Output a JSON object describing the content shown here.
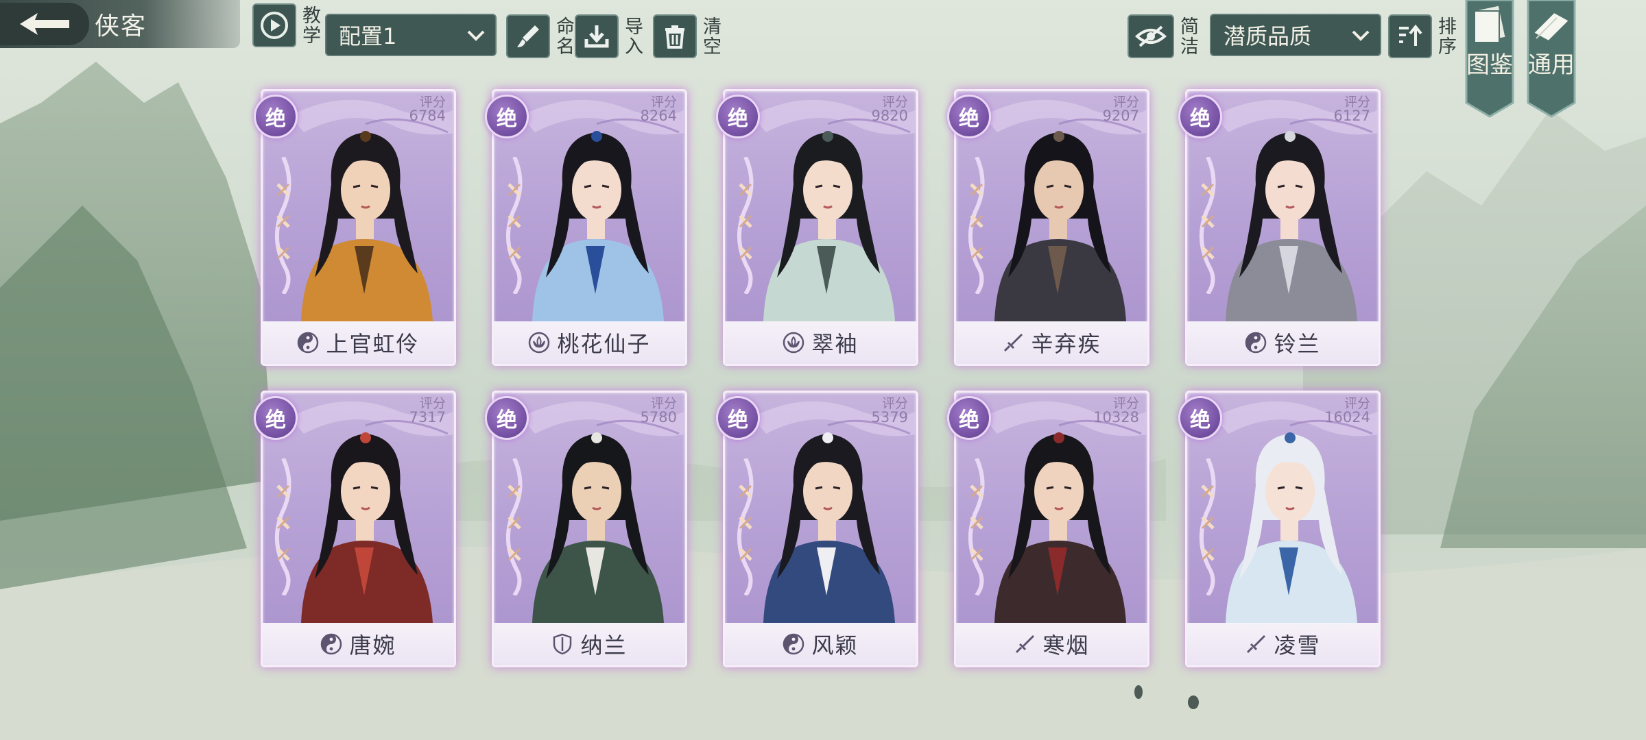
{
  "header": {
    "title": "侠客",
    "tutorial_label": "教学",
    "config_select": "配置1",
    "rename_label": "命名",
    "import_label": "导入",
    "clear_label": "清空",
    "simple_label": "简洁",
    "sort_select": "潜质品质",
    "sort_label": "排序",
    "atlas_label": "图鉴",
    "general_label": "通用"
  },
  "score_label": "评分",
  "colors": {
    "card_purple": "#b7a2d6",
    "card_glow": "#c878dc",
    "toolbar_teal": "#3f5853",
    "grade_badge": "#7a55a8"
  },
  "heroes": [
    {
      "name": "上官虹伶",
      "score": "6784",
      "grade": "绝",
      "faction_icon": "yin-yang-icon",
      "attire": "#d08a34",
      "hair": "#1c1a1f",
      "skin": "#f0d2b8",
      "accent": "#5b3b1e"
    },
    {
      "name": "桃花仙子",
      "score": "8264",
      "grade": "绝",
      "faction_icon": "lotus-icon",
      "attire": "#9fc3e6",
      "hair": "#18171d",
      "skin": "#f3dccd",
      "accent": "#2a4f9a"
    },
    {
      "name": "翠袖",
      "score": "9820",
      "grade": "绝",
      "faction_icon": "lotus-icon",
      "attire": "#c6d8d2",
      "hair": "#1b1c20",
      "skin": "#f3dccb",
      "accent": "#4a5b58"
    },
    {
      "name": "辛弃疾",
      "score": "9207",
      "grade": "绝",
      "faction_icon": "sword-icon",
      "attire": "#3a3840",
      "hair": "#15141a",
      "skin": "#e7c9b1",
      "accent": "#6d5a4c"
    },
    {
      "name": "铃兰",
      "score": "6127",
      "grade": "绝",
      "faction_icon": "yin-yang-icon",
      "attire": "#8c8c98",
      "hair": "#1a1a20",
      "skin": "#f4ddd0",
      "accent": "#d6d6de"
    },
    {
      "name": "唐婉",
      "score": "7317",
      "grade": "绝",
      "faction_icon": "yin-yang-icon",
      "attire": "#7e2a26",
      "hair": "#19171c",
      "skin": "#f2d6c2",
      "accent": "#c0463a"
    },
    {
      "name": "纳兰",
      "score": "5780",
      "grade": "绝",
      "faction_icon": "shield-icon",
      "attire": "#3d5449",
      "hair": "#16171b",
      "skin": "#ecd0b6",
      "accent": "#e8e6e0"
    },
    {
      "name": "风颖",
      "score": "5379",
      "grade": "绝",
      "faction_icon": "yin-yang-icon",
      "attire": "#324a7e",
      "hair": "#1b1a20",
      "skin": "#f1d6c4",
      "accent": "#efeef2"
    },
    {
      "name": "寒烟",
      "score": "10328",
      "grade": "绝",
      "faction_icon": "sword-icon",
      "attire": "#3c2a2c",
      "hair": "#17161a",
      "skin": "#f0d3bf",
      "accent": "#8a2a2a"
    },
    {
      "name": "凌雪",
      "score": "16024",
      "grade": "绝",
      "faction_icon": "sword-icon",
      "attire": "#d7e6f0",
      "hair": "#e9ecf3",
      "skin": "#f6e1d6",
      "accent": "#3a66a8"
    }
  ]
}
